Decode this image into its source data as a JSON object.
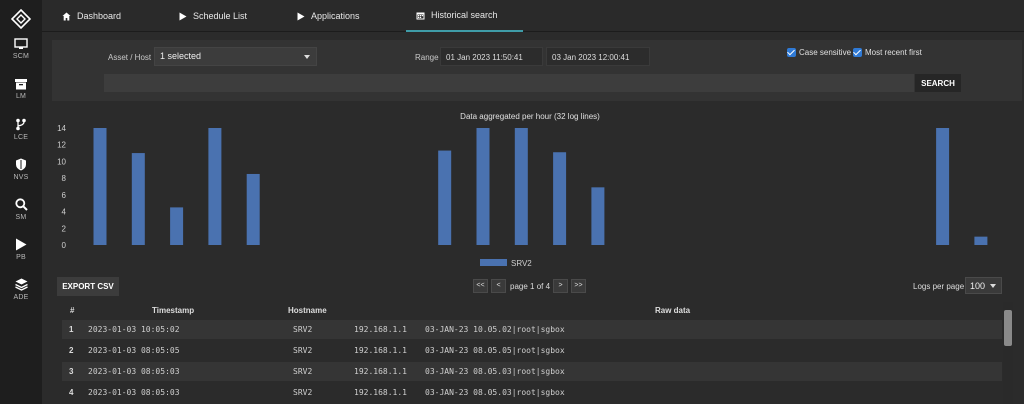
{
  "sidebar": {
    "items": [
      {
        "label": "SCM",
        "icon": "monitor-icon"
      },
      {
        "label": "LM",
        "icon": "archive-icon"
      },
      {
        "label": "LCE",
        "icon": "branch-icon"
      },
      {
        "label": "NVS",
        "icon": "shield-icon"
      },
      {
        "label": "SM",
        "icon": "search-icon"
      },
      {
        "label": "PB",
        "icon": "play-icon"
      },
      {
        "label": "ADE",
        "icon": "layers-icon"
      }
    ]
  },
  "tabs": [
    {
      "label": "Dashboard",
      "icon": "home-icon"
    },
    {
      "label": "Schedule List",
      "icon": "play-icon"
    },
    {
      "label": "Applications",
      "icon": "play-icon"
    },
    {
      "label": "Historical search",
      "icon": "calendar-icon",
      "active": true
    }
  ],
  "search": {
    "asset_label": "Asset / Host",
    "asset_value": "1 selected",
    "range_label": "Range",
    "range_from": "01 Jan 2023 11:50:41",
    "range_to": "03 Jan 2023 12:00:41",
    "case_sensitive_label": "Case sensitive",
    "most_recent_label": "Most recent first",
    "query": "",
    "search_button": "SEARCH"
  },
  "chart_data": {
    "type": "bar",
    "title": "Data aggregated per hour (32 log lines)",
    "ylim": [
      0,
      14
    ],
    "yticks": [
      0,
      2,
      4,
      6,
      8,
      10,
      12,
      14
    ],
    "legend": "bottom-center",
    "series": [
      {
        "name": "SRV2",
        "color": "#4a72b0",
        "values": [
          14,
          11,
          4.5,
          14,
          8.5,
          0,
          0,
          0,
          0,
          11.3,
          14,
          14,
          11.1,
          6.9,
          0,
          0,
          0,
          0,
          0,
          0,
          0,
          0,
          14,
          1
        ]
      }
    ]
  },
  "pager": {
    "export_button": "EXPORT CSV",
    "first": "<<",
    "prev": "<",
    "info": "page 1 of 4",
    "next": ">",
    "last": ">>",
    "logs_per_page_label": "Logs per page",
    "logs_per_page_value": "100"
  },
  "table": {
    "columns": [
      "#",
      "Timestamp",
      "Hostname",
      "Raw data"
    ],
    "rows": [
      {
        "n": "1",
        "timestamp": "2023-01-03 10:05:02",
        "host": "SRV2",
        "ip": "192.168.1.1",
        "raw": "03-JAN-23 10.05.02|root|sgbox"
      },
      {
        "n": "2",
        "timestamp": "2023-01-03 08:05:05",
        "host": "SRV2",
        "ip": "192.168.1.1",
        "raw": "03-JAN-23 08.05.05|root|sgbox"
      },
      {
        "n": "3",
        "timestamp": "2023-01-03 08:05:03",
        "host": "SRV2",
        "ip": "192.168.1.1",
        "raw": "03-JAN-23 08.05.03|root|sgbox"
      },
      {
        "n": "4",
        "timestamp": "2023-01-03 08:05:03",
        "host": "SRV2",
        "ip": "192.168.1.1",
        "raw": "03-JAN-23 08.05.03|root|sgbox"
      }
    ]
  }
}
